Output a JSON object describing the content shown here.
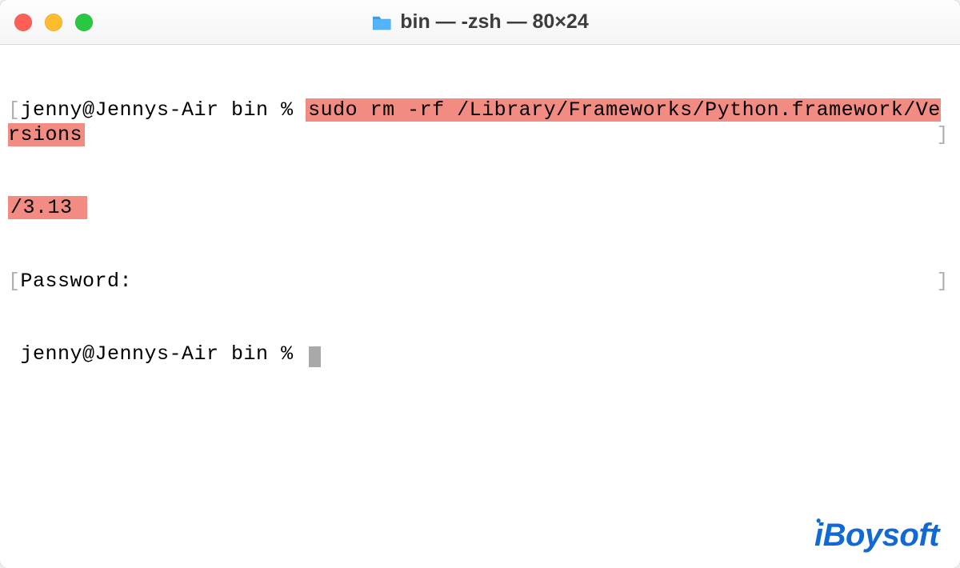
{
  "window": {
    "title": "bin — -zsh — 80×24"
  },
  "terminal": {
    "prompt1_prefix": "jenny@Jennys-Air bin % ",
    "command_highlighted_line1": "sudo rm -rf /Library/Frameworks/Python.framework/Versions",
    "command_highlighted_line2": "/3.13 ",
    "password_label": "Password:",
    "prompt2": "jenny@Jennys-Air bin % "
  },
  "watermark": {
    "text": "iBoysoft"
  },
  "colors": {
    "highlight_bg": "#f28b82",
    "close": "#ff5f57",
    "minimize": "#febc2e",
    "maximize": "#28c840",
    "watermark": "#1169d6"
  }
}
